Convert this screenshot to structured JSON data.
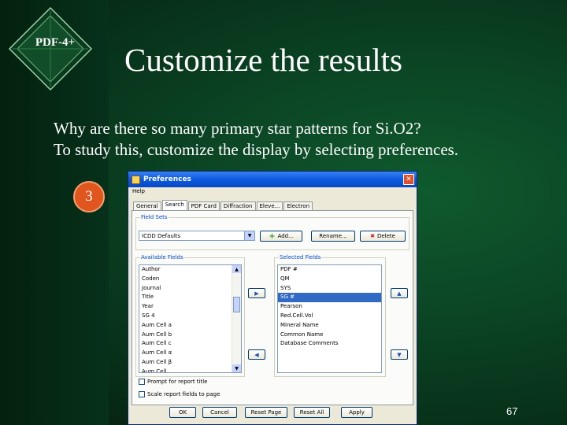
{
  "slide": {
    "logo_text": "PDF-4+",
    "title": "Customize the results",
    "lines": [
      "Why are there so many primary star patterns for Si.O2?",
      "To study this, customize the display by selecting preferences."
    ],
    "step_badge": "3",
    "page_number": "67"
  },
  "dialog": {
    "title": "Preferences",
    "menu": [
      "Help"
    ],
    "tabs": [
      "General",
      "Search",
      "PDF Card",
      "Diffraction",
      "Eleve...",
      "Electron"
    ],
    "active_tab": "Search",
    "field_sets": {
      "label": "Field Sets",
      "selected": "ICDD Defaults",
      "add_label": "Add...",
      "rename_label": "Rename...",
      "delete_label": "Delete"
    },
    "available": {
      "label": "Available Fields",
      "items": [
        "Author",
        "Coden",
        "Journal",
        "Title",
        "Year",
        "SG 4",
        "Aum Cell a",
        "Aum Cell b",
        "Aum Cell c",
        "Aum Cell α",
        "Aum Cell β",
        "Aum Cell..."
      ]
    },
    "selected_fields": {
      "label": "Selected Fields",
      "items": [
        "PDF #",
        "QM",
        "SYS",
        "SG #",
        "Pearson",
        "Red.Cell.Vol",
        "Mineral Name",
        "Common Name",
        "Database Comments"
      ],
      "selected_index": 3
    },
    "options": [
      "Prompt for report title",
      "Scale report fields to page"
    ],
    "buttons": [
      "OK",
      "Cancel",
      "Reset Page",
      "Reset All",
      "Apply"
    ]
  },
  "colors": {
    "bg": "#0b4424",
    "step": "#e0561e",
    "title_bar": "#0a5ae0",
    "selection": "#316ac5"
  }
}
